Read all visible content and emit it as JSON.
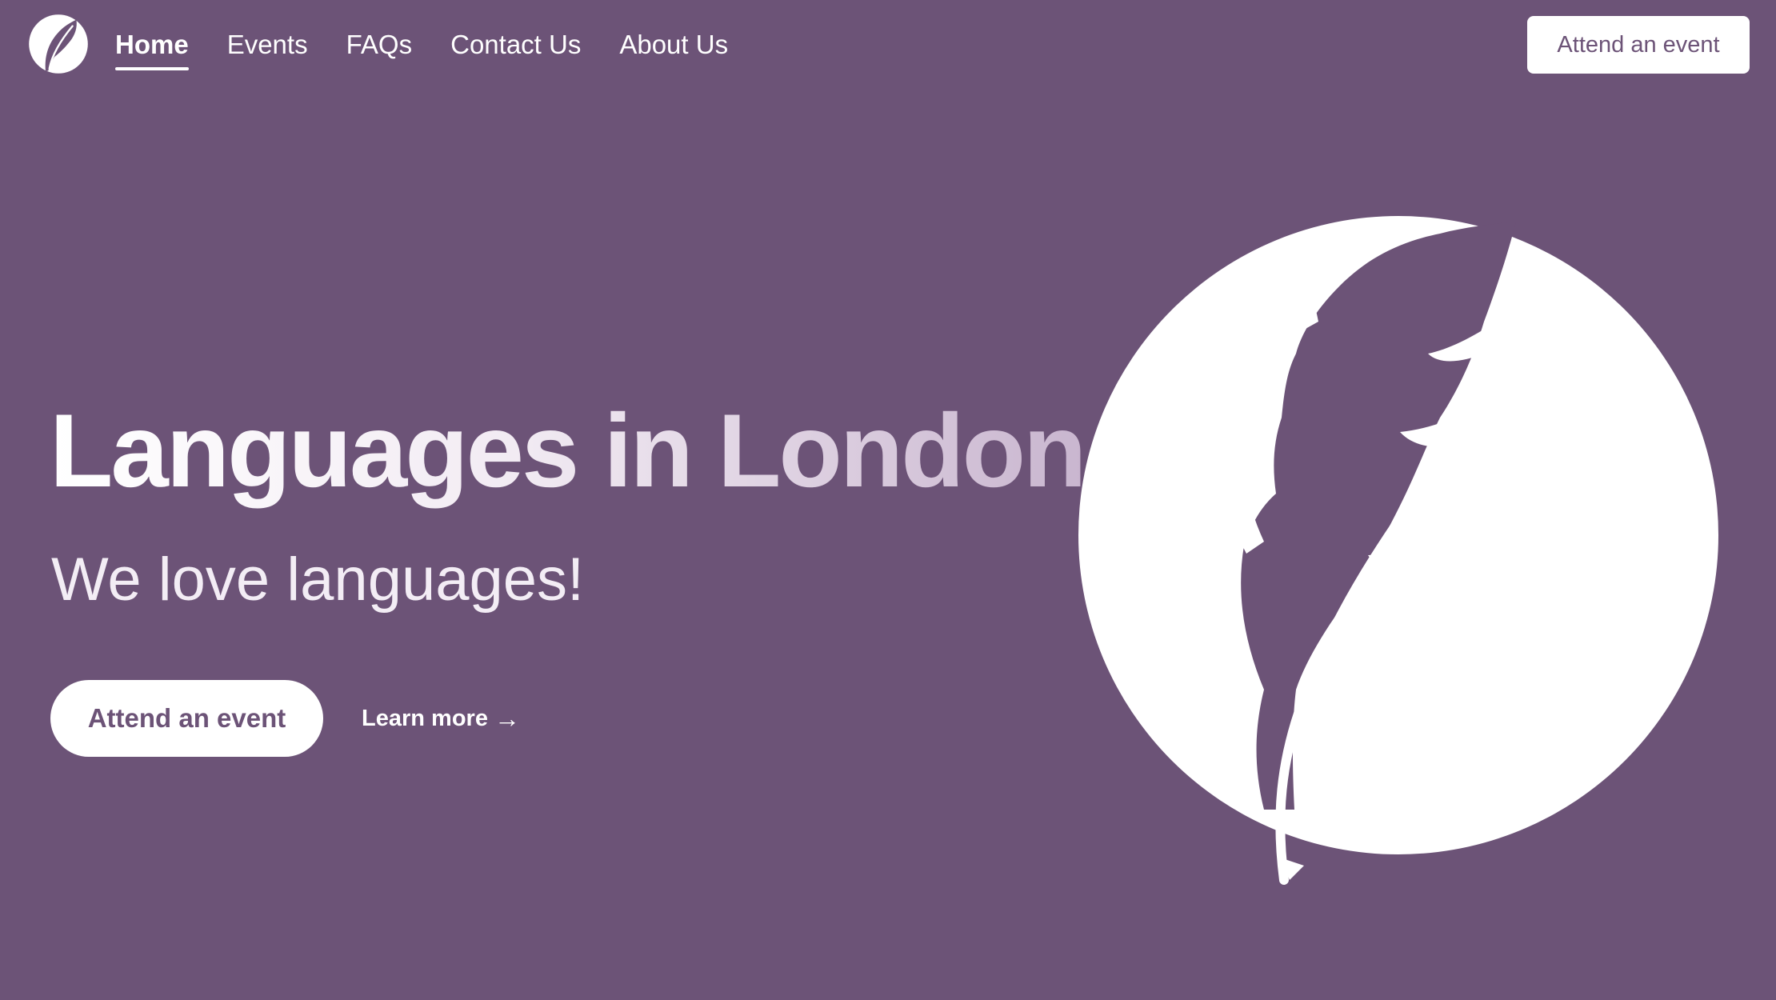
{
  "header": {
    "logo_icon": "feather-logo-icon",
    "nav": [
      {
        "label": "Home",
        "active": true
      },
      {
        "label": "Events",
        "active": false
      },
      {
        "label": "FAQs",
        "active": false
      },
      {
        "label": "Contact Us",
        "active": false
      },
      {
        "label": "About Us",
        "active": false
      }
    ],
    "cta_label": "Attend an event"
  },
  "hero": {
    "title": "Languages in London",
    "subtitle": "We love languages!",
    "primary_button": "Attend an event",
    "link_label": "Learn more",
    "link_arrow": "→",
    "illustration_icon": "feather-circle-icon"
  },
  "colors": {
    "background": "#6c5377",
    "foreground": "#ffffff",
    "accent_text": "#6c5377"
  }
}
